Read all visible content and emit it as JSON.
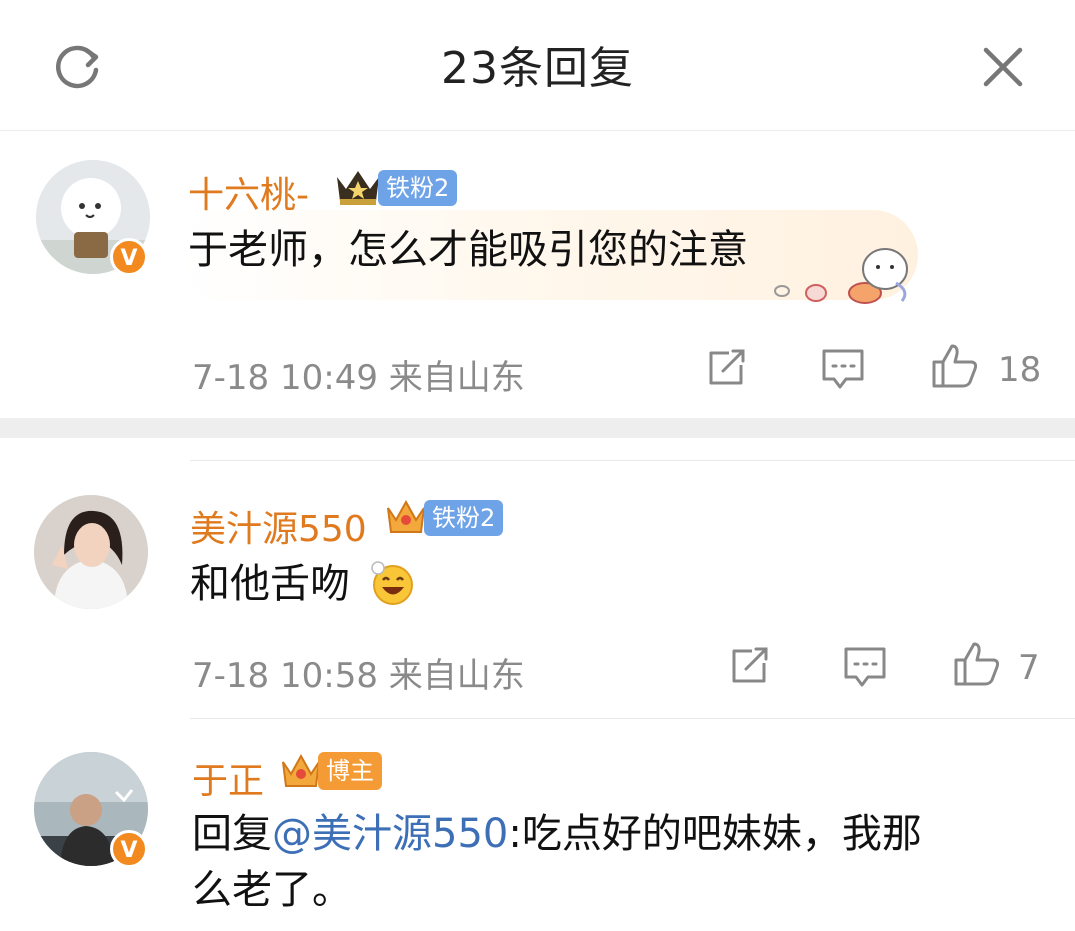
{
  "header": {
    "title": "23条回复"
  },
  "comments": [
    {
      "username": "十六桃-",
      "fan_badge": "铁粉2",
      "text": "于老师，怎么才能吸引您的注意",
      "time_location": "7-18 10:49 来自山东",
      "likes": "18",
      "verified": "V"
    },
    {
      "username": "美汁源550",
      "fan_badge": "铁粉2",
      "text": "和他舌吻",
      "time_location": "7-18 10:58 来自山东",
      "likes": "7"
    },
    {
      "username": "于正",
      "blogger_badge": "博主",
      "reply_prefix": "回复",
      "mention": "@美汁源550",
      "text_line1": ":吃点好的吧妹妹，我那",
      "text_line2": "么老了。",
      "verified": "V"
    }
  ],
  "colors": {
    "username": "#e07a1f",
    "mention": "#3d6fb6",
    "fan_badge": "#6fa3e8",
    "blogger_badge": "#f59b35"
  }
}
